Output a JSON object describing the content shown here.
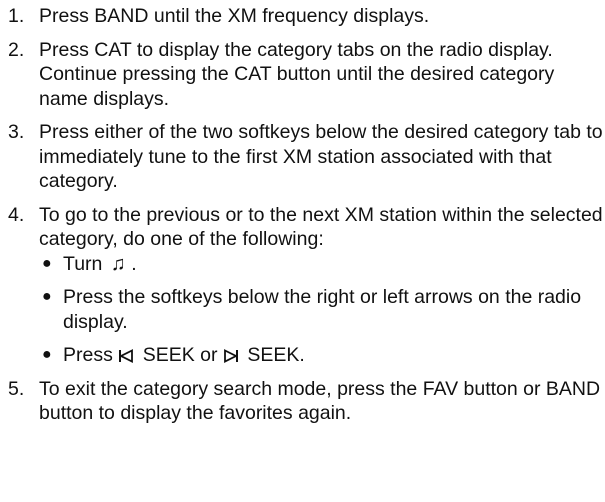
{
  "steps": [
    {
      "number": "1.",
      "text": "Press BAND until the XM frequency displays."
    },
    {
      "number": "2.",
      "text": "Press CAT to display the category tabs on the radio display. Continue pressing the CAT button until the desired category name displays."
    },
    {
      "number": "3.",
      "text": "Press either of the two softkeys below the desired category tab to immediately tune to the first XM station associated with that category."
    },
    {
      "number": "4.",
      "text": "To go to the previous or to the next XM station within the selected category, do one of the following:",
      "bullets": {
        "turn": {
          "prefix": "Turn",
          "suffix": "."
        },
        "softkeys": "Press the softkeys below the right or left arrows on the radio display.",
        "seek": {
          "prefix": "Press",
          "seek_back": "SEEK or",
          "seek_fwd": "SEEK."
        }
      }
    },
    {
      "number": "5.",
      "text": "To exit the category search mode, press the FAV button or BAND button to display the favorites again."
    }
  ],
  "icons": {
    "bullet": "bullet-dot",
    "music": "music-note-icon",
    "seek_back": "seek-back-icon",
    "seek_forward": "seek-forward-icon"
  }
}
